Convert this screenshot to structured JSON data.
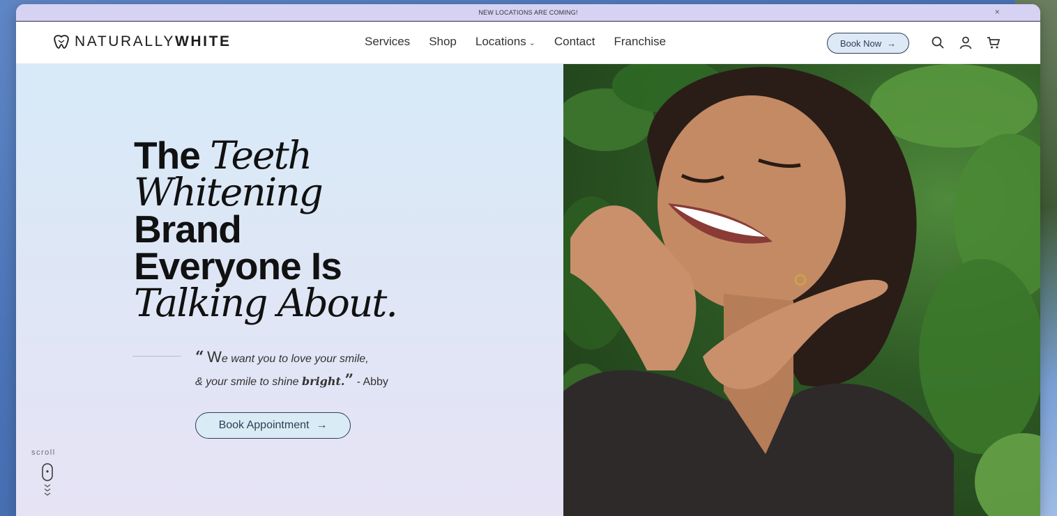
{
  "announcement": {
    "text": "NEW LOCATIONS ARE COMING!",
    "close": "×"
  },
  "brand": {
    "logo_light": "NATURALLY",
    "logo_bold": "WHITE"
  },
  "nav": {
    "items": [
      "Services",
      "Shop",
      "Locations",
      "Contact",
      "Franchise"
    ],
    "locations_chevron": "⌄",
    "book_now": "Book Now",
    "book_now_arrow": "→"
  },
  "icons": [
    "search-icon",
    "account-icon",
    "cart-icon",
    "scroll-mouse-icon",
    "tooth-logo-icon",
    "arrow-right-icon"
  ],
  "hero": {
    "headline": {
      "w1": "The",
      "w2": "Teeth",
      "w3": "Whitening",
      "w4": "Brand",
      "w5": "Everyone Is",
      "w6": "Talking About."
    },
    "quote": {
      "open_mark": "“",
      "first_letter": "W",
      "line1_rest": "e want you to love your smile,",
      "line2": "& your smile to shine",
      "bright": "bright.",
      "close_mark": "”",
      "author": "- Abby"
    },
    "cta": "Book Appointment",
    "cta_arrow": "→",
    "scroll_label": "scroll"
  },
  "colors": {
    "announcement_bg": "#d6d2f3",
    "button_border": "#2e3d55",
    "hero_left_top": "#d7eaf8",
    "hero_left_bottom": "#e6e3f5"
  }
}
